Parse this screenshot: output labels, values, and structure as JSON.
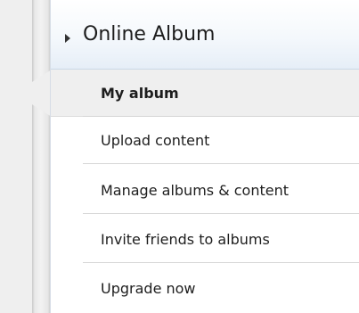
{
  "header": {
    "title": "Online Album",
    "expand_icon": "right-triangle-icon"
  },
  "menu": {
    "items": [
      {
        "label": "My album",
        "active": true
      },
      {
        "label": "Upload content"
      },
      {
        "label": "Manage albums & content"
      },
      {
        "label": "Invite friends to albums"
      },
      {
        "label": "Upgrade now"
      }
    ]
  },
  "colors": {
    "header_bg_bottom": "#e6eef7",
    "active_bg": "#efefef",
    "divider": "#d6d6d6",
    "text": "#1d1d1d"
  }
}
